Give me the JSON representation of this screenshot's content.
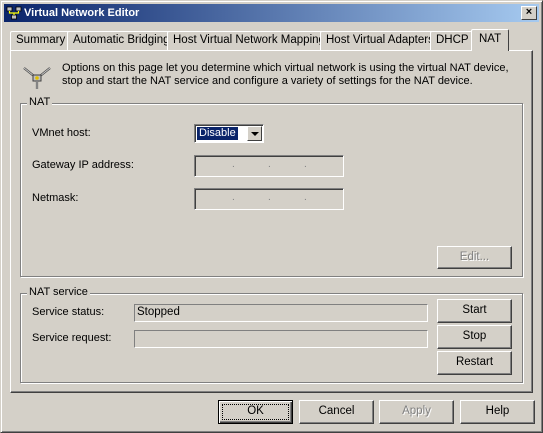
{
  "window": {
    "title": "Virtual Network Editor"
  },
  "tabs": [
    {
      "label": "Summary"
    },
    {
      "label": "Automatic Bridging"
    },
    {
      "label": "Host Virtual Network Mapping"
    },
    {
      "label": "Host Virtual Adapters"
    },
    {
      "label": "DHCP"
    },
    {
      "label": "NAT"
    }
  ],
  "active_tab": "NAT",
  "info": {
    "text": "Options on this page let you determine which virtual network is using the virtual NAT device, stop and start the NAT service and configure a variety of settings for the NAT device."
  },
  "nat_group": {
    "legend": "NAT",
    "vmnet_host_label": "VMnet host:",
    "vmnet_host_value": "Disable",
    "gateway_label": "Gateway IP address:",
    "gateway_value": ". . .",
    "netmask_label": "Netmask:",
    "netmask_value": ". . .",
    "edit_button": "Edit..."
  },
  "service_group": {
    "legend": "NAT service",
    "status_label": "Service status:",
    "status_value": "Stopped",
    "request_label": "Service request:",
    "request_value": "",
    "start_button": "Start",
    "stop_button": "Stop",
    "restart_button": "Restart"
  },
  "footer": {
    "ok": "OK",
    "cancel": "Cancel",
    "apply": "Apply",
    "help": "Help"
  },
  "colors": {
    "titlebar_start": "#0a246a",
    "titlebar_end": "#a6caf0",
    "face": "#d4d0c8",
    "selection": "#0a246a"
  }
}
